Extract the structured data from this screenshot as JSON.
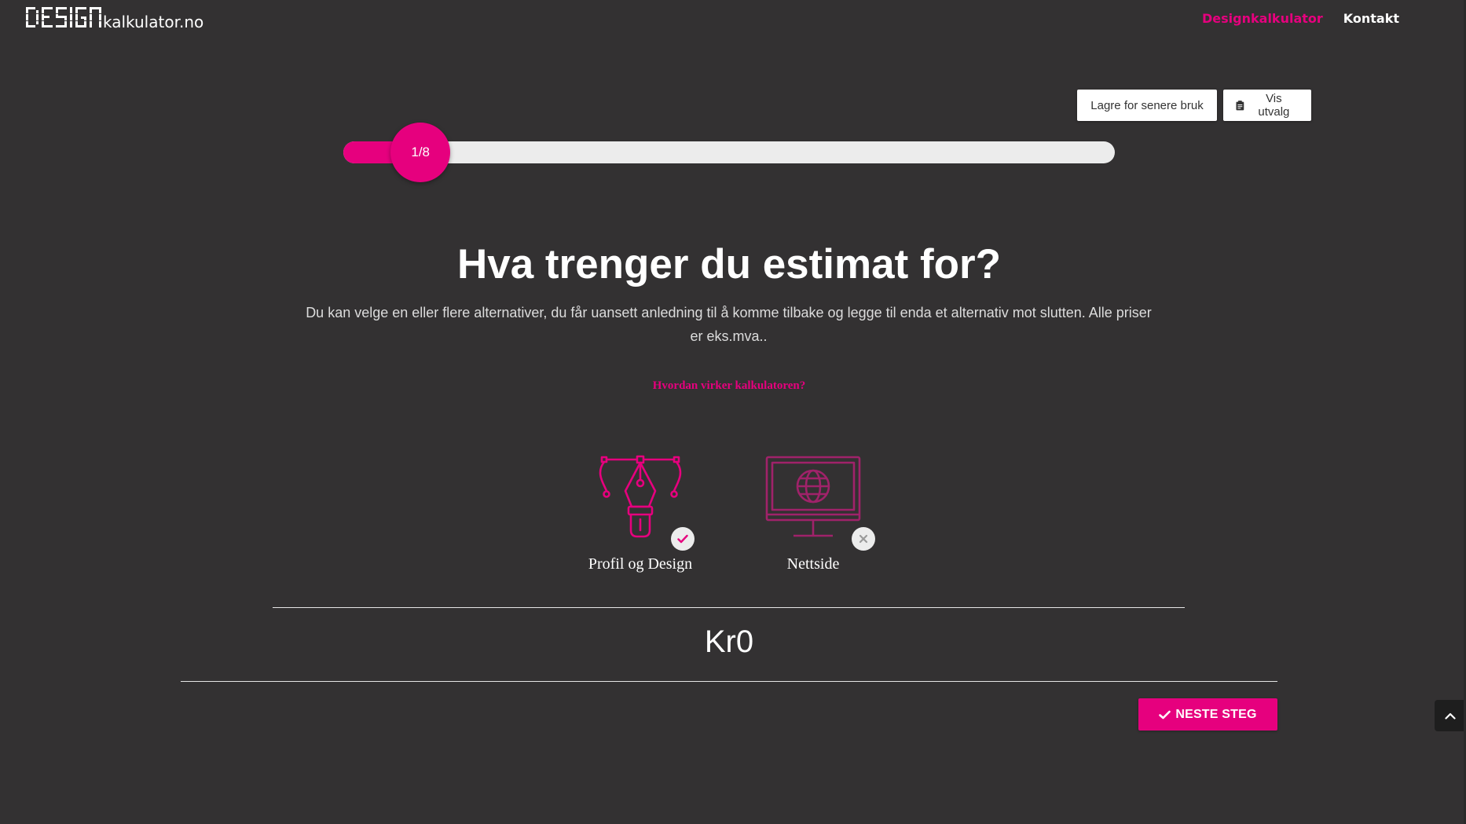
{
  "header": {
    "logo_text": "kalkulator.no",
    "logo_mark": "DESIGN",
    "nav": [
      {
        "label": "Designkalkulator",
        "active": true
      },
      {
        "label": "Kontakt",
        "active": false
      }
    ]
  },
  "toolbar": {
    "save_label": "Lagre for senere bruk",
    "view_label": "Vis utvalg",
    "view_icon": "clipboard-icon"
  },
  "progress": {
    "label": "1/8",
    "current": 1,
    "total": 8
  },
  "main": {
    "title": "Hva trenger du estimat for?",
    "subtitle": "Du kan velge en eller flere alternativer, du får uansett anledning til å komme tilbake og legge til enda et alternativ mot slutten. Alle priser er eks.mva..",
    "how_link": "Hvordan virker kalkulatoren?"
  },
  "options": [
    {
      "label": "Profil og Design",
      "icon": "pen-tool-icon",
      "selected": true
    },
    {
      "label": "Nettside",
      "icon": "monitor-globe-icon",
      "selected": false
    }
  ],
  "price": {
    "value": "Kr0"
  },
  "next_button": {
    "label": "NESTE STEG",
    "icon": "check-icon"
  },
  "colors": {
    "accent": "#e6007e",
    "background": "#333132",
    "option_unselected": "#a0226a"
  }
}
